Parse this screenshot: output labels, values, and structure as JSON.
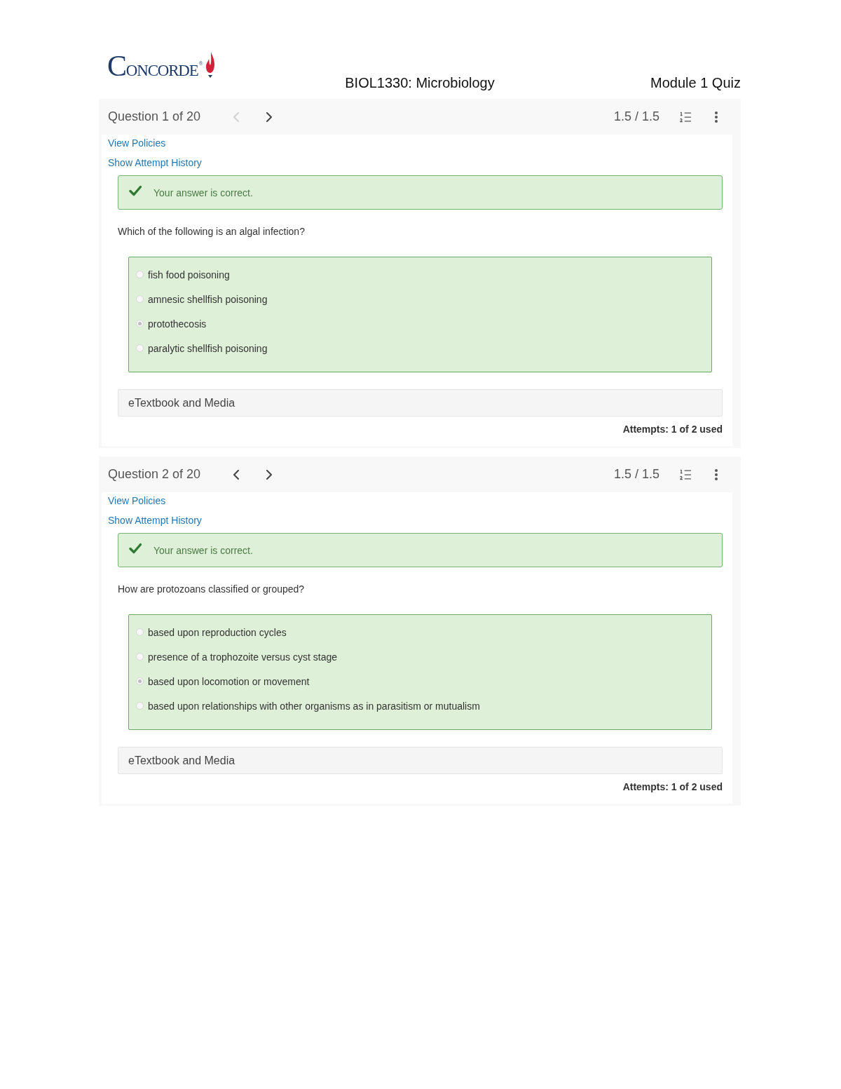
{
  "header": {
    "logo": {
      "name": "CONCORDE",
      "mark": "®"
    },
    "course": "BIOL1330: Microbiology",
    "quiz": "Module 1 Quiz"
  },
  "questions": [
    {
      "position": "Question 1 of 20",
      "nav": {
        "prev": {
          "disabled": true
        },
        "next": {
          "disabled": false
        }
      },
      "score": "1.5 / 1.5",
      "links": [
        "View Policies",
        "Show Attempt History"
      ],
      "feedback": {
        "text": "Your answer is correct.",
        "correct": true
      },
      "prompt": "Which of the following is an algal infection?",
      "options": [
        {
          "label": "fish food poisoning",
          "selected": false
        },
        {
          "label": "amnesic shellfish poisoning",
          "selected": false
        },
        {
          "label": "protothecosis",
          "selected": true
        },
        {
          "label": "paralytic shellfish poisoning",
          "selected": false
        }
      ],
      "resource": "eTextbook and Media",
      "attempts": "Attempts: 1 of 2 used"
    },
    {
      "position": "Question 2 of 20",
      "nav": {
        "prev": {
          "disabled": false
        },
        "next": {
          "disabled": false
        }
      },
      "score": "1.5 / 1.5",
      "links": [
        "View Policies",
        "Show Attempt History"
      ],
      "feedback": {
        "text": "Your answer is correct.",
        "correct": true
      },
      "prompt": "How are protozoans classified or grouped?",
      "options": [
        {
          "label": "based upon reproduction cycles",
          "selected": false
        },
        {
          "label": "presence of a trophozoite versus cyst stage",
          "selected": false
        },
        {
          "label": "based upon locomotion or movement",
          "selected": true
        },
        {
          "label": "based upon relationships with other organisms as in parasitism or mutualism",
          "selected": false
        }
      ],
      "resource": "eTextbook and Media",
      "attempts": "Attempts: 1 of 2 used"
    }
  ]
}
